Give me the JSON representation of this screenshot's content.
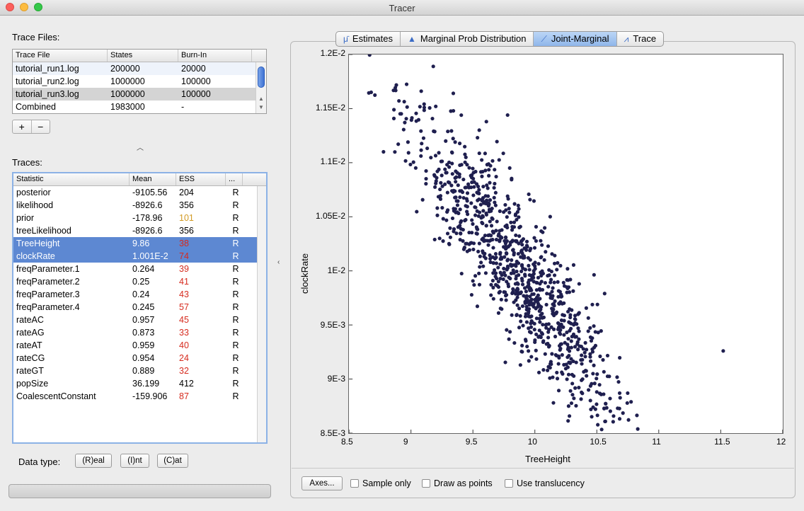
{
  "window": {
    "title": "Tracer"
  },
  "trace_files": {
    "label": "Trace Files:",
    "columns": [
      "Trace File",
      "States",
      "Burn-In"
    ],
    "rows": [
      {
        "file": "tutorial_run1.log",
        "states": "200000",
        "burnin": "20000"
      },
      {
        "file": "tutorial_run2.log",
        "states": "1000000",
        "burnin": "100000"
      },
      {
        "file": "tutorial_run3.log",
        "states": "1000000",
        "burnin": "100000"
      },
      {
        "file": "Combined",
        "states": "1983000",
        "burnin": "-"
      }
    ],
    "add_label": "+",
    "remove_label": "−"
  },
  "traces": {
    "label": "Traces:",
    "columns": [
      "Statistic",
      "Mean",
      "ESS",
      "..."
    ],
    "rows": [
      {
        "stat": "posterior",
        "mean": "-9105.56",
        "ess": "204",
        "type": "R",
        "ess_color": "#000000"
      },
      {
        "stat": "likelihood",
        "mean": "-8926.6",
        "ess": "356",
        "type": "R",
        "ess_color": "#000000"
      },
      {
        "stat": "prior",
        "mean": "-178.96",
        "ess": "101",
        "type": "R",
        "ess_color": "#d29a24"
      },
      {
        "stat": "treeLikelihood",
        "mean": "-8926.6",
        "ess": "356",
        "type": "R",
        "ess_color": "#000000"
      },
      {
        "stat": "TreeHeight",
        "mean": "9.86",
        "ess": "38",
        "type": "R",
        "ess_color": "#d62b1e"
      },
      {
        "stat": "clockRate",
        "mean": "1.001E-2",
        "ess": "74",
        "type": "R",
        "ess_color": "#d62b1e"
      },
      {
        "stat": "freqParameter.1",
        "mean": "0.264",
        "ess": "39",
        "type": "R",
        "ess_color": "#d62b1e"
      },
      {
        "stat": "freqParameter.2",
        "mean": "0.25",
        "ess": "41",
        "type": "R",
        "ess_color": "#d62b1e"
      },
      {
        "stat": "freqParameter.3",
        "mean": "0.24",
        "ess": "43",
        "type": "R",
        "ess_color": "#d62b1e"
      },
      {
        "stat": "freqParameter.4",
        "mean": "0.245",
        "ess": "57",
        "type": "R",
        "ess_color": "#d62b1e"
      },
      {
        "stat": "rateAC",
        "mean": "0.957",
        "ess": "45",
        "type": "R",
        "ess_color": "#d62b1e"
      },
      {
        "stat": "rateAG",
        "mean": "0.873",
        "ess": "33",
        "type": "R",
        "ess_color": "#d62b1e"
      },
      {
        "stat": "rateAT",
        "mean": "0.959",
        "ess": "40",
        "type": "R",
        "ess_color": "#d62b1e"
      },
      {
        "stat": "rateCG",
        "mean": "0.954",
        "ess": "24",
        "type": "R",
        "ess_color": "#d62b1e"
      },
      {
        "stat": "rateGT",
        "mean": "0.889",
        "ess": "32",
        "type": "R",
        "ess_color": "#d62b1e"
      },
      {
        "stat": "popSize",
        "mean": "36.199",
        "ess": "412",
        "type": "R",
        "ess_color": "#000000"
      },
      {
        "stat": "CoalescentConstant",
        "mean": "-159.906",
        "ess": "87",
        "type": "R",
        "ess_color": "#d62b1e"
      }
    ]
  },
  "data_type": {
    "label": "Data type:",
    "real": "(R)eal",
    "int": "(I)nt",
    "cat": "(C)at"
  },
  "tabs": [
    {
      "label": "Estimates",
      "icon": "mu-bar-icon"
    },
    {
      "label": "Marginal Prob Distribution",
      "icon": "triangle-icon"
    },
    {
      "label": "Joint-Marginal",
      "icon": "diagonal-line-icon"
    },
    {
      "label": "Trace",
      "icon": "trace-wave-icon"
    }
  ],
  "bottom_controls": {
    "axes_button": "Axes...",
    "sample_only": "Sample only",
    "draw_as_points": "Draw as points",
    "use_translucency": "Use translucency"
  },
  "chart_data": {
    "type": "scatter",
    "title": "",
    "xlabel": "TreeHeight",
    "ylabel": "clockRate",
    "xlim": [
      8.5,
      12
    ],
    "ylim": [
      0.0085,
      0.012
    ],
    "x_ticks": [
      "8.5",
      "9",
      "9.5",
      "10",
      "10.5",
      "11",
      "11.5",
      "12"
    ],
    "y_ticks": [
      "8.5E-3",
      "9E-3",
      "9.5E-3",
      "1E-2",
      "1.05E-2",
      "1.1E-2",
      "1.15E-2",
      "1.2E-2"
    ],
    "point_color": "#1f1f4f",
    "trend": {
      "x_mean": 9.86,
      "y_mean": 0.01001,
      "slope": -0.00145,
      "x_sd": 0.44,
      "y_resid_sd": 0.00033,
      "n": 1000
    },
    "outliers": [
      [
        9.18,
        0.01189
      ],
      [
        9.2,
        0.01152
      ],
      [
        9.78,
        0.01144
      ],
      [
        11.52,
        0.00926
      ],
      [
        10.15,
        0.00878
      ],
      [
        10.47,
        0.00874
      ]
    ]
  },
  "colors": {
    "selection_blue": "#5d88d2",
    "ess_low": "#d62b1e",
    "ess_mid": "#d29a24"
  }
}
